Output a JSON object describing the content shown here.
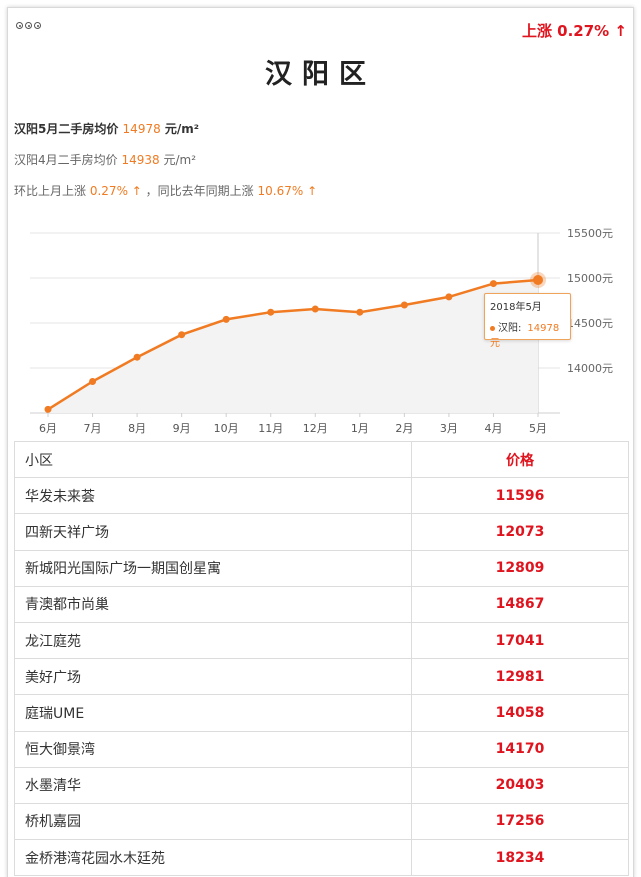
{
  "header": {
    "change_badge": "上涨 0.27% ↑",
    "title": "汉阳区"
  },
  "stats": {
    "current_label": "汉阳5月二手房均价",
    "current_value": "14978",
    "current_unit": "元/m²",
    "prev_label": "汉阳4月二手房均价",
    "prev_value": "14938",
    "prev_unit": "元/m²",
    "compare_prefix": "环比上月上涨",
    "mom_value": "0.27% ↑",
    "compare_mid": "，同比去年同期上涨",
    "yoy_value": "10.67% ↑"
  },
  "chart_data": {
    "type": "line",
    "categories": [
      "6月",
      "7月",
      "8月",
      "9月",
      "10月",
      "11月",
      "12月",
      "1月",
      "2月",
      "3月",
      "4月",
      "5月"
    ],
    "series": [
      {
        "name": "汉阳",
        "values": [
          13540,
          13850,
          14120,
          14370,
          14540,
          14620,
          14655,
          14620,
          14700,
          14790,
          14938,
          14978
        ]
      }
    ],
    "ylim": [
      13500,
      15500
    ],
    "y_ticks": [
      14000,
      14500,
      15000,
      15500
    ],
    "y_tick_labels": [
      "14000元",
      "14500元",
      "15000元",
      "15500元"
    ],
    "colors": {
      "line": "#f07b22",
      "grid": "#e5e5e5"
    },
    "tooltip": {
      "date": "2018年5月",
      "series": "汉阳:",
      "value": "14978元"
    }
  },
  "table": {
    "headers": [
      "小区",
      "价格"
    ],
    "rows": [
      [
        "华发未来荟",
        "11596"
      ],
      [
        "四新天祥广场",
        "12073"
      ],
      [
        "新城阳光国际广场一期国创星寓",
        "12809"
      ],
      [
        "青澳都市尚巢",
        "14867"
      ],
      [
        "龙江庭苑",
        "17041"
      ],
      [
        "美好广场",
        "12981"
      ],
      [
        "庭瑞UME",
        "14058"
      ],
      [
        "恒大御景湾",
        "14170"
      ],
      [
        "水墨清华",
        "20403"
      ],
      [
        "桥机嘉园",
        "17256"
      ],
      [
        "金桥港湾花园水木廷苑",
        "18234"
      ]
    ]
  }
}
